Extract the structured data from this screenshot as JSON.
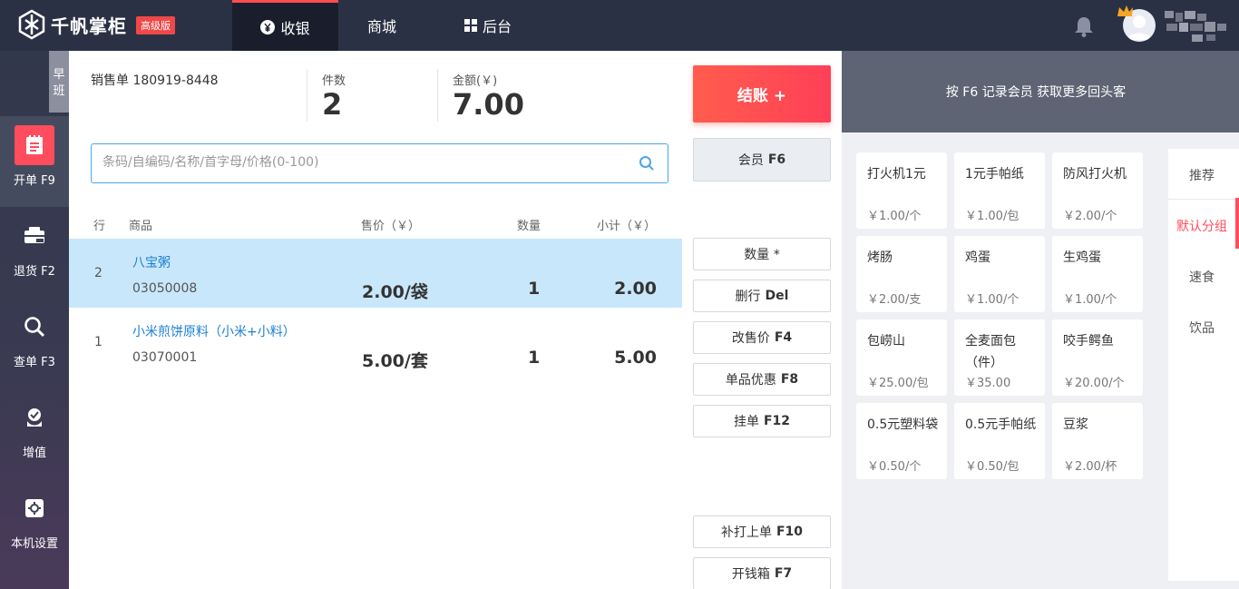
{
  "app": {
    "name": "千帆掌柜",
    "edition_badge": "高级版"
  },
  "nav": [
    {
      "label": "收银",
      "icon": "yen-circle-icon",
      "active": true
    },
    {
      "label": "商城",
      "icon": "",
      "active": false
    },
    {
      "label": "后台",
      "icon": "grid-icon",
      "active": false
    }
  ],
  "sidebar": {
    "shift_tab": "早班",
    "items": [
      {
        "label": "开单 F9",
        "icon": "new-order-icon",
        "active": true
      },
      {
        "label": "退货 F2",
        "icon": "return-icon",
        "active": false
      },
      {
        "label": "查单 F3",
        "icon": "search-icon",
        "active": false
      },
      {
        "label": "增值",
        "icon": "value-added-icon",
        "active": false
      },
      {
        "label": "本机设置",
        "icon": "settings-icon",
        "active": false
      }
    ]
  },
  "summary": {
    "sale_no": "销售单 180919-8448",
    "count_label": "件数",
    "count_value": "2",
    "amount_label": "金额(￥)",
    "amount_value": "7.00"
  },
  "search": {
    "placeholder": "条码/自编码/名称/首字母/价格(0-100)"
  },
  "table": {
    "headers": {
      "row": "行",
      "product": "商品",
      "price": "售价（￥）",
      "qty": "数量",
      "subtotal": "小计（￥）"
    },
    "rows": [
      {
        "idx": "2",
        "name": "八宝粥",
        "code": "03050008",
        "price": "2.00/袋",
        "qty": "1",
        "subtotal": "2.00",
        "selected": true
      },
      {
        "idx": "1",
        "name": "小米煎饼原料（小米+小料）",
        "code": "03070001",
        "price": "5.00/套",
        "qty": "1",
        "subtotal": "5.00",
        "selected": false
      }
    ]
  },
  "actions": {
    "pay": "结账 +",
    "member_label": "会员",
    "member_key": "F6",
    "qty_label": "数量 *",
    "delete_label": "删行",
    "delete_key": "Del",
    "price_label": "改售价",
    "price_key": "F4",
    "discount_label": "单品优惠",
    "discount_key": "F8",
    "hold_label": "挂单",
    "hold_key": "F12",
    "reprint_label": "补打上单",
    "reprint_key": "F10",
    "drawer_label": "开钱箱",
    "drawer_key": "F7"
  },
  "member_tip": "按 F6 记录会员 获取更多回头客",
  "products": [
    {
      "name": "打火机1元",
      "price": "￥1.00/个"
    },
    {
      "name": "1元手帕纸",
      "price": "￥1.00/包"
    },
    {
      "name": "防风打火机",
      "price": "￥2.00/个"
    },
    {
      "name": "烤肠",
      "price": "￥2.00/支"
    },
    {
      "name": "鸡蛋",
      "price": "￥1.00/个"
    },
    {
      "name": "生鸡蛋",
      "price": "￥1.00/个"
    },
    {
      "name": "包崂山",
      "price": "￥25.00/包"
    },
    {
      "name": "全麦面包（件）",
      "price": "￥35.00"
    },
    {
      "name": "咬手鳄鱼",
      "price": "￥20.00/个"
    },
    {
      "name": "0.5元塑料袋",
      "price": "￥0.50/个"
    },
    {
      "name": "0.5元手帕纸",
      "price": "￥0.50/包"
    },
    {
      "name": "豆浆",
      "price": "￥2.00/杯"
    }
  ],
  "categories": [
    {
      "label": "推荐",
      "active": false
    },
    {
      "label": "默认分组",
      "active": true
    },
    {
      "label": "速食",
      "active": false
    },
    {
      "label": "饮品",
      "active": false
    }
  ],
  "colors": {
    "accent": "#ff4d5e",
    "topbar": "#2b3144",
    "selected_row": "#c9e7fb",
    "link": "#1a7fd0"
  }
}
